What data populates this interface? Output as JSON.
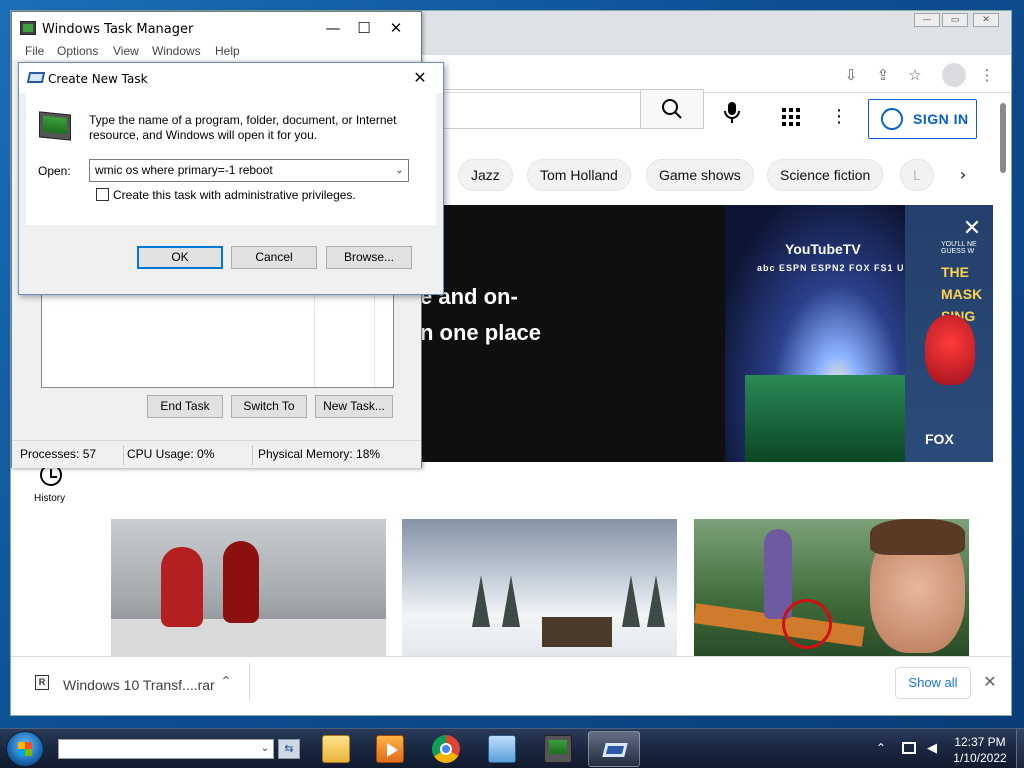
{
  "taskmanager": {
    "title": "Windows Task Manager",
    "menu": [
      "File",
      "Options",
      "View",
      "Windows",
      "Help"
    ],
    "buttons": {
      "end_task": "End Task",
      "switch_to": "Switch To",
      "new_task": "New Task..."
    },
    "status": {
      "processes": "Processes: 57",
      "cpu": "CPU Usage: 0%",
      "memory": "Physical Memory: 18%"
    }
  },
  "dialog": {
    "title": "Create New Task",
    "message": "Type the name of a program, folder, document, or Internet resource, and Windows will open it for you.",
    "open_label": "Open:",
    "open_value": "wmic os where primary=-1 reboot",
    "checkbox_label": "Create this task with administrative privileges.",
    "checkbox_checked": false,
    "ok": "OK",
    "cancel": "Cancel",
    "browse": "Browse..."
  },
  "youtube": {
    "signin": "SIGN IN",
    "chips": [
      "Jazz",
      "Tom Holland",
      "Game shows",
      "Science fiction",
      "L"
    ],
    "banner": {
      "line1": "e and on-",
      "line2": "n one place",
      "tv_logo": "YouTubeTV",
      "networks": "abc ESPN ESPN2 FOX FS1 U",
      "mask_title": "THE MASK SING",
      "mask_sub": "YOU'LL NE GUESS W",
      "fox": "FOX"
    },
    "sidebar": {
      "history_label": "History"
    }
  },
  "download_bar": {
    "file_name": "Windows 10 Transf....rar",
    "show_all": "Show all"
  },
  "taskbar": {
    "address_value": "",
    "clock_time": "12:37 PM",
    "clock_date": "1/10/2022"
  }
}
